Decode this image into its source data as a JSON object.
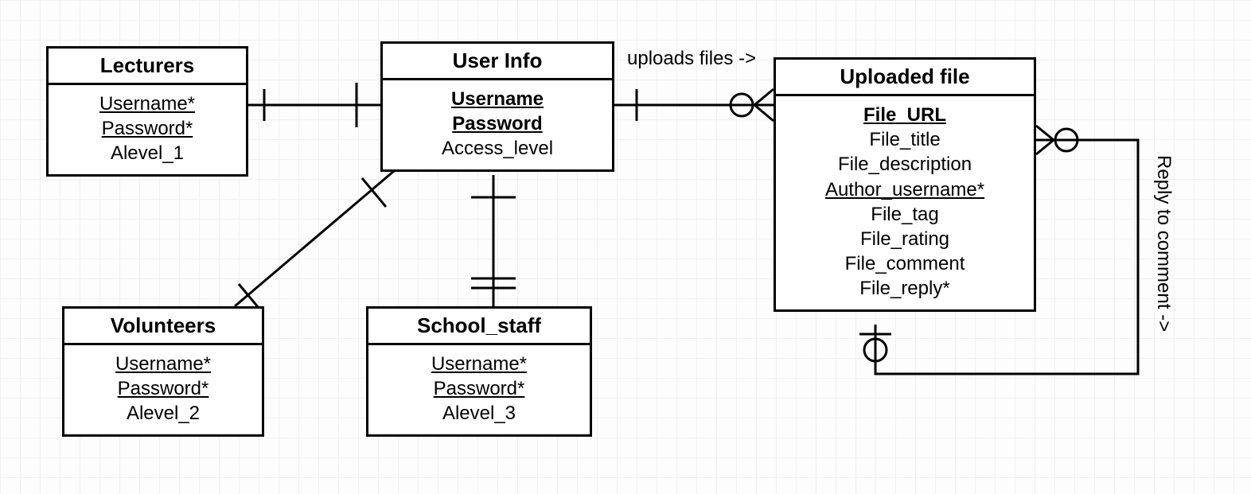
{
  "entities": {
    "lecturers": {
      "title": "Lecturers",
      "attrs": [
        {
          "text": "Username*",
          "cls": "fk"
        },
        {
          "text": "Password*",
          "cls": "fk"
        },
        {
          "text": "Alevel_1",
          "cls": ""
        }
      ]
    },
    "userinfo": {
      "title": "User Info",
      "attrs": [
        {
          "text": "Username",
          "cls": "key"
        },
        {
          "text": "Password",
          "cls": "key"
        },
        {
          "text": "Access_level",
          "cls": ""
        }
      ]
    },
    "volunteers": {
      "title": "Volunteers",
      "attrs": [
        {
          "text": "Username*",
          "cls": "fk"
        },
        {
          "text": "Password*",
          "cls": "fk"
        },
        {
          "text": "Alevel_2",
          "cls": ""
        }
      ]
    },
    "schoolstaff": {
      "title": "School_staff",
      "attrs": [
        {
          "text": "Username*",
          "cls": "fk"
        },
        {
          "text": "Password*",
          "cls": "fk"
        },
        {
          "text": "Alevel_3",
          "cls": ""
        }
      ]
    },
    "uploadedfile": {
      "title": "Uploaded file",
      "attrs": [
        {
          "text": "File_URL",
          "cls": "key"
        },
        {
          "text": "File_title",
          "cls": ""
        },
        {
          "text": "File_description",
          "cls": ""
        },
        {
          "text": "Author_username*",
          "cls": "fk"
        },
        {
          "text": "File_tag",
          "cls": ""
        },
        {
          "text": "File_rating",
          "cls": ""
        },
        {
          "text": "File_comment",
          "cls": ""
        },
        {
          "text": "File_reply*",
          "cls": ""
        }
      ]
    }
  },
  "labels": {
    "uploads": "uploads files ->",
    "reply": "Reply to comment ->"
  }
}
